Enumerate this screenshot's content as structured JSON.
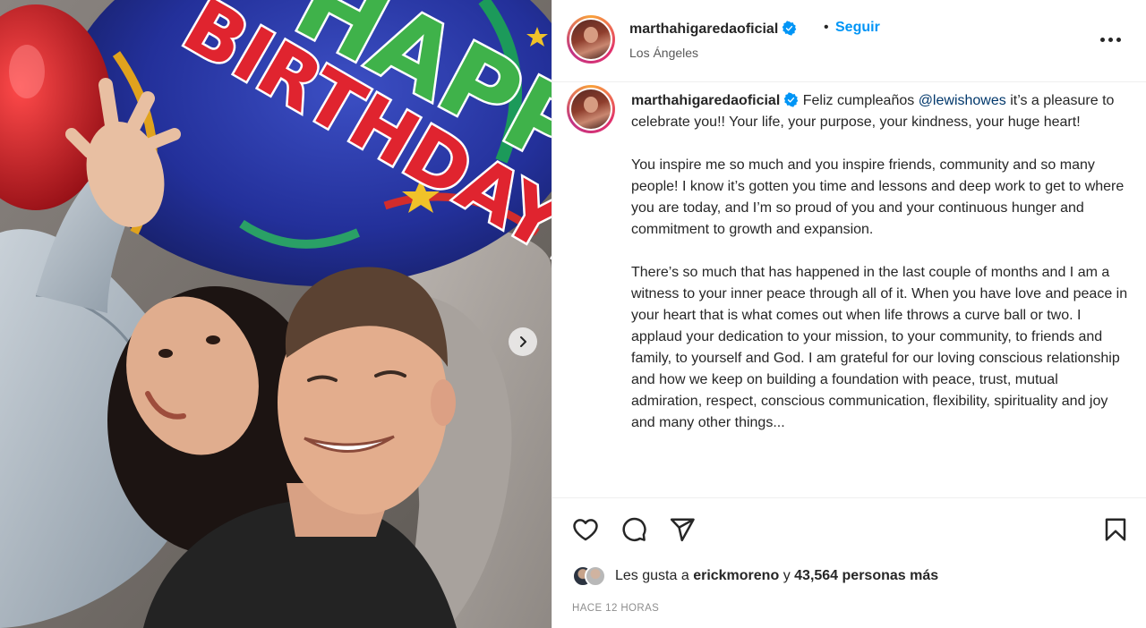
{
  "post": {
    "username": "marthahigaredaoficial",
    "follow_label": "Seguir",
    "separator": "•",
    "location": "Los Ángeles"
  },
  "caption": {
    "intro": "Feliz cumpleaños",
    "mention": "@lewishowes",
    "line1_rest": "it’s a pleasure to celebrate you!! Your life, your purpose, your kindness, your huge heart!",
    "para2": "You inspire me so much and you inspire friends, community and so many people! I know it’s gotten you time and lessons and deep work to get to where you are today, and I’m so proud of you and your continuous hunger and commitment to growth and expansion.",
    "para3": "There’s so much that has happened in the last couple of months and I am a witness to your inner peace through all of it. When you have love and peace in your heart that is what comes out when life throws a curve ball or two. I applaud your dedication to your mission, to your community, to friends and family, to yourself and God. I am grateful for our loving conscious relationship and how we keep on building a foundation with peace, trust, mutual admiration, respect, conscious communication, flexibility, spirituality and joy and many other things..."
  },
  "balloon": {
    "line1": "HAPPY",
    "line2": "BIRTHDAY!"
  },
  "likes": {
    "prefix": "Les gusta a",
    "user": "erickmoreno",
    "connector": "y",
    "others": "43,564 personas más"
  },
  "timestamp": "HACE 12 HORAS",
  "icons": {
    "verified": "verified-badge-icon",
    "more": "more-options-icon",
    "like": "heart-icon",
    "comment": "comment-icon",
    "share": "send-icon",
    "save": "bookmark-icon",
    "next": "chevron-right-icon"
  },
  "colors": {
    "accent": "#0095f6",
    "mention": "#00376b",
    "muted": "#8e8e8e"
  }
}
